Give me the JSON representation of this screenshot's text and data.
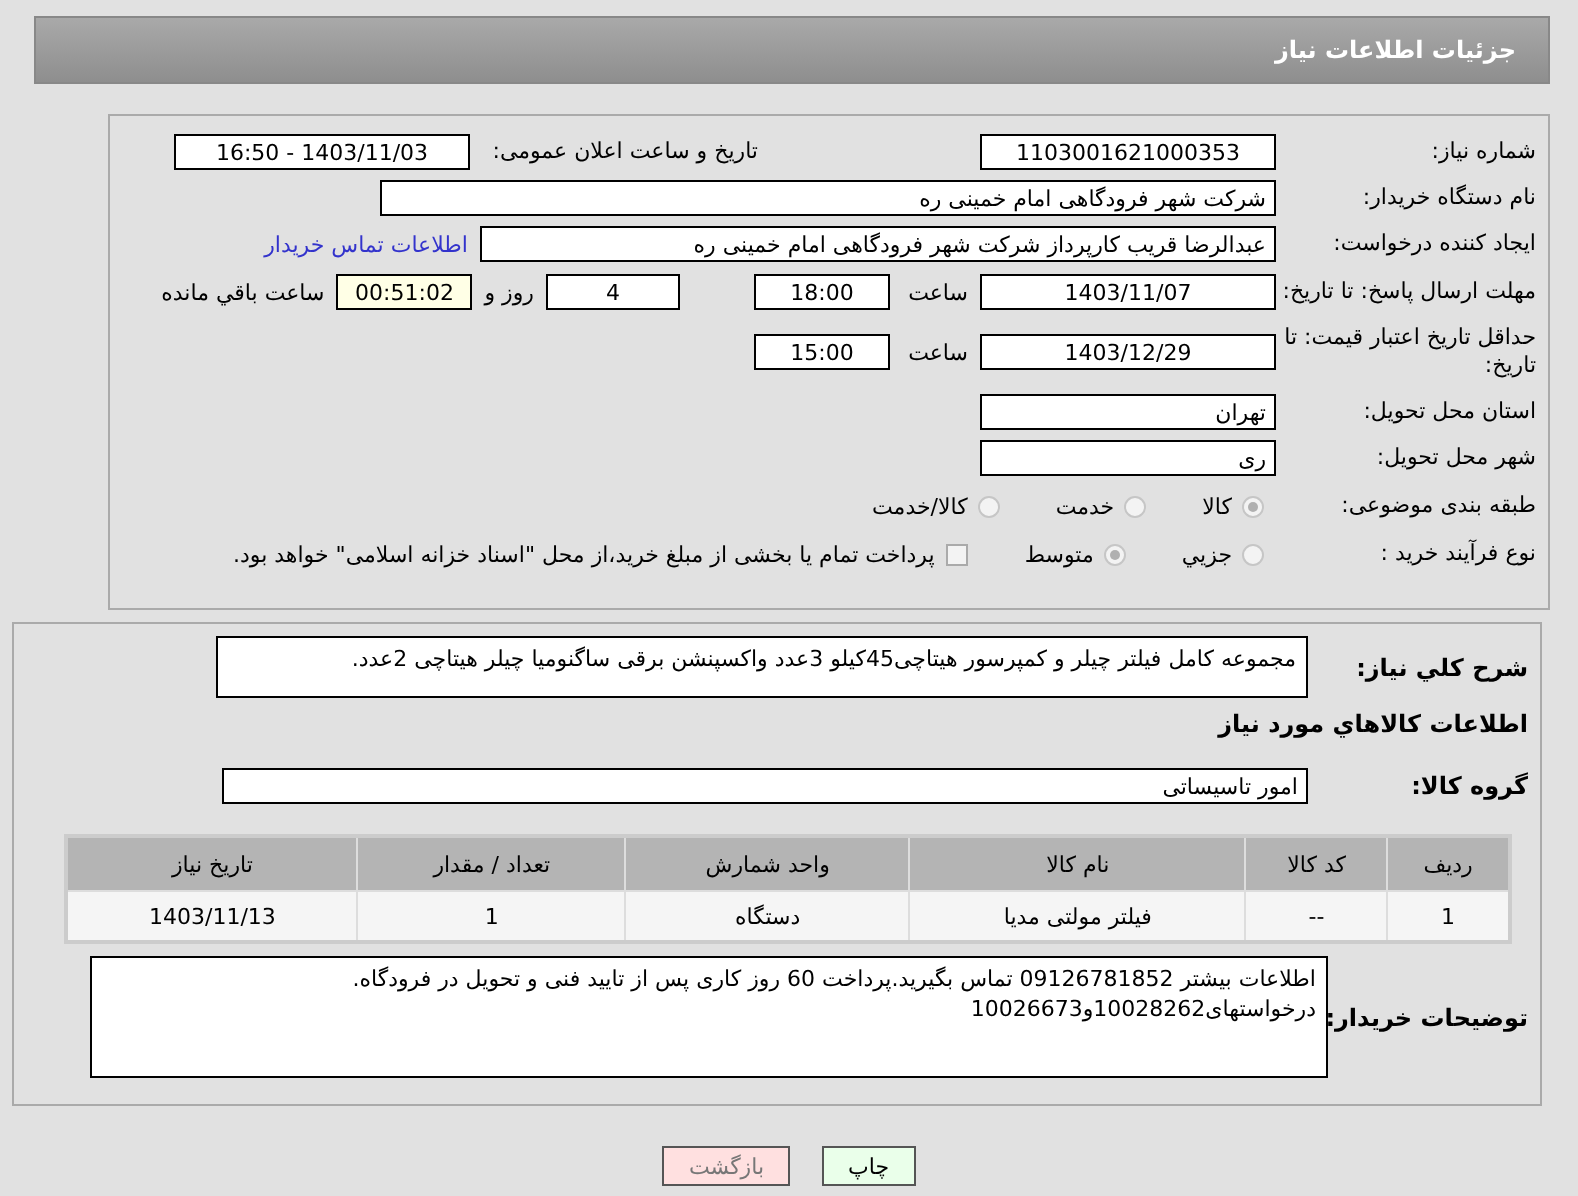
{
  "header": {
    "title": "جزئیات اطلاعات نیاز"
  },
  "need_number": {
    "label": "شماره نیاز:",
    "value": "1103001621000353"
  },
  "announce": {
    "label": "تاریخ و ساعت اعلان عمومی:",
    "value": "1403/11/03 - 16:50"
  },
  "buyer": {
    "label": "نام دستگاه خریدار:",
    "value": "شرکت شهر فرودگاهی امام خمینی  ره"
  },
  "creator": {
    "label": "ایجاد کننده درخواست:",
    "value": "عبدالرضا قریب کارپرداز شرکت شهر فرودگاهی امام خمینی  ره",
    "link": "اطلاعات تماس خریدار"
  },
  "reply_deadline": {
    "label": "مهلت ارسال پاسخ: تا تاریخ:",
    "date": "1403/11/07",
    "time_label": "ساعت",
    "time": "18:00",
    "days": "4",
    "days_label": "روز و",
    "remaining": "00:51:02",
    "remaining_label": "ساعت باقي مانده"
  },
  "price_validity": {
    "label": "حداقل تاریخ اعتبار قیمت: تا تاریخ:",
    "date": "1403/12/29",
    "time_label": "ساعت",
    "time": "15:00"
  },
  "province": {
    "label": "استان محل تحویل:",
    "value": "تهران"
  },
  "city": {
    "label": "شهر محل تحویل:",
    "value": "ری"
  },
  "category": {
    "label": "طبقه بندی موضوعی:",
    "disabled": true,
    "options": [
      {
        "label": "کالا",
        "selected": true
      },
      {
        "label": "خدمت",
        "selected": false
      },
      {
        "label": "کالا/خدمت",
        "selected": false
      }
    ]
  },
  "purchase_type": {
    "label": "نوع فرآیند خرید :",
    "disabled": true,
    "options": [
      {
        "label": "جزیي",
        "selected": false
      },
      {
        "label": "متوسط",
        "selected": true
      }
    ],
    "treasury": {
      "checked": false,
      "text": "پرداخت تمام یا بخشی از مبلغ خرید،از محل \"اسناد خزانه اسلامی\" خواهد بود."
    }
  },
  "description": {
    "label": "شرح کلي نياز:",
    "value": "مجموعه کامل فیلتر چیلر و کمپرسور هیتاچی45کیلو 3عدد واکسپنشن برقی ساگنومیا چیلر هیتاچی 2عدد."
  },
  "goods_heading": "اطلاعات کالاهاي مورد نياز",
  "goods_group": {
    "label": "گروه کالا:",
    "value": "امور تاسیساتی"
  },
  "table": {
    "columns": [
      "ردیف",
      "کد کالا",
      "نام کالا",
      "واحد شمارش",
      "تعداد / مقدار",
      "تاریخ نیاز"
    ],
    "rows": [
      [
        "1",
        "--",
        "فیلتر مولتی مدیا",
        "دستگاه",
        "1",
        "1403/11/13"
      ]
    ]
  },
  "buyer_notes": {
    "label": "توضیحات خریدار:",
    "lines": [
      "اطلاعات بیشتر 09126781852 تماس بگیرید.پرداخت 60 روز کاری پس از تایید فنی و تحویل در فرودگاه.",
      "درخواستهای10028262و10026673"
    ]
  },
  "buttons": [
    {
      "label": "چاپ",
      "kind": "print"
    },
    {
      "label": "بازگشت",
      "kind": "back"
    }
  ]
}
